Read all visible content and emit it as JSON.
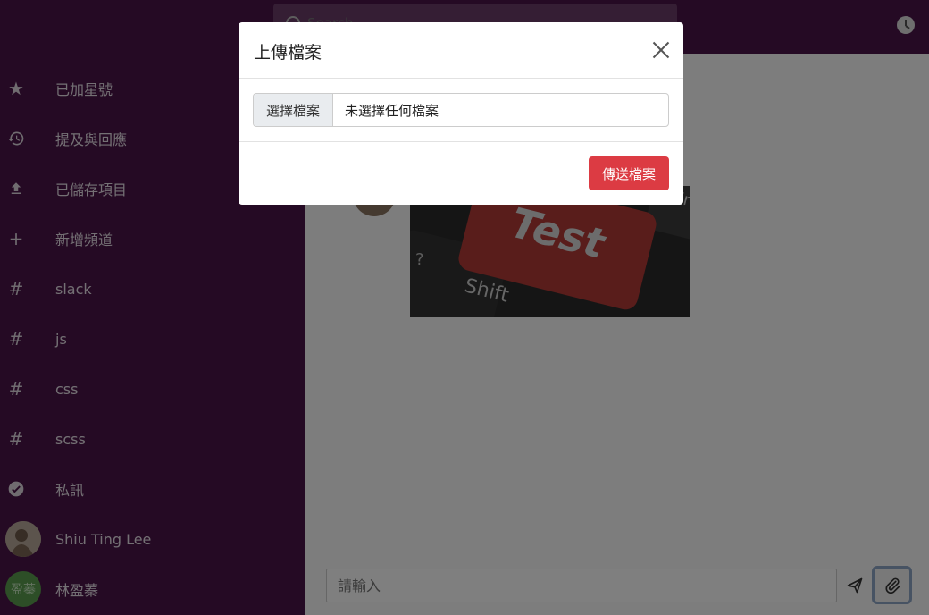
{
  "search": {
    "placeholder": "Search"
  },
  "sidebar": {
    "items": [
      {
        "label": "已加星號",
        "icon": "star-icon"
      },
      {
        "label": "提及與回應",
        "icon": "history-icon"
      },
      {
        "label": "已儲存項目",
        "icon": "upload-icon"
      },
      {
        "label": "新增頻道",
        "icon": "plus-icon"
      },
      {
        "label": "slack",
        "icon": "hash-icon"
      },
      {
        "label": "js",
        "icon": "hash-icon"
      },
      {
        "label": "css",
        "icon": "hash-icon"
      },
      {
        "label": "scss",
        "icon": "hash-icon"
      },
      {
        "label": "私訊",
        "icon": "check-circle-icon"
      }
    ],
    "users": [
      {
        "name": "Shiu Ting Lee"
      },
      {
        "name": "林盈蓁",
        "initials": "盈蓁"
      }
    ]
  },
  "message": {
    "image_text": {
      "test": "Test",
      "shift": "Shift",
      "question": "?",
      "enter": "Er"
    }
  },
  "composer": {
    "placeholder": "請輸入"
  },
  "modal": {
    "title": "上傳檔案",
    "choose_label": "選擇檔案",
    "file_name": "未選擇任何檔案",
    "submit_label": "傳送檔案"
  }
}
